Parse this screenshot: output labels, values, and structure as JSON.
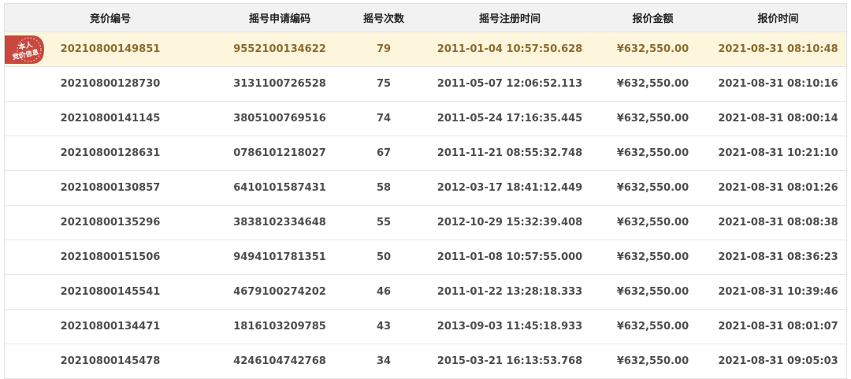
{
  "table": {
    "columns": [
      "竞价编号",
      "摇号申请编码",
      "摇号次数",
      "摇号注册时间",
      "报价金额",
      "报价时间"
    ],
    "badge": {
      "line1": "本人",
      "line2": "竞价信息"
    },
    "rows": [
      {
        "bid_id": "20210800149851",
        "lottery_code": "9552100134622",
        "count": "79",
        "reg_time": "2011-01-04 10:57:50.628",
        "amount": "¥632,550.00",
        "bid_time": "2021-08-31 08:10:48"
      },
      {
        "bid_id": "20210800128730",
        "lottery_code": "3131100726528",
        "count": "75",
        "reg_time": "2011-05-07 12:06:52.113",
        "amount": "¥632,550.00",
        "bid_time": "2021-08-31 08:10:16"
      },
      {
        "bid_id": "20210800141145",
        "lottery_code": "3805100769516",
        "count": "74",
        "reg_time": "2011-05-24 17:16:35.445",
        "amount": "¥632,550.00",
        "bid_time": "2021-08-31 08:00:14"
      },
      {
        "bid_id": "20210800128631",
        "lottery_code": "0786101218027",
        "count": "67",
        "reg_time": "2011-11-21 08:55:32.748",
        "amount": "¥632,550.00",
        "bid_time": "2021-08-31 10:21:10"
      },
      {
        "bid_id": "20210800130857",
        "lottery_code": "6410101587431",
        "count": "58",
        "reg_time": "2012-03-17 18:41:12.449",
        "amount": "¥632,550.00",
        "bid_time": "2021-08-31 08:01:26"
      },
      {
        "bid_id": "20210800135296",
        "lottery_code": "3838102334648",
        "count": "55",
        "reg_time": "2012-10-29 15:32:39.408",
        "amount": "¥632,550.00",
        "bid_time": "2021-08-31 08:08:38"
      },
      {
        "bid_id": "20210800151506",
        "lottery_code": "9494101781351",
        "count": "50",
        "reg_time": "2011-01-08 10:57:55.000",
        "amount": "¥632,550.00",
        "bid_time": "2021-08-31 08:36:23"
      },
      {
        "bid_id": "20210800145541",
        "lottery_code": "4679100274202",
        "count": "46",
        "reg_time": "2011-01-22 13:28:18.333",
        "amount": "¥632,550.00",
        "bid_time": "2021-08-31 10:39:46"
      },
      {
        "bid_id": "20210800134471",
        "lottery_code": "1816103209785",
        "count": "43",
        "reg_time": "2013-09-03 11:45:18.933",
        "amount": "¥632,550.00",
        "bid_time": "2021-08-31 08:01:07"
      },
      {
        "bid_id": "20210800145478",
        "lottery_code": "4246104742768",
        "count": "34",
        "reg_time": "2015-03-21 16:13:53.768",
        "amount": "¥632,550.00",
        "bid_time": "2021-08-31 09:05:03"
      }
    ]
  },
  "colors": {
    "highlight_bg": "#fdf5dc",
    "highlight_text": "#8b6a2e",
    "badge_red": "#c8483d"
  }
}
